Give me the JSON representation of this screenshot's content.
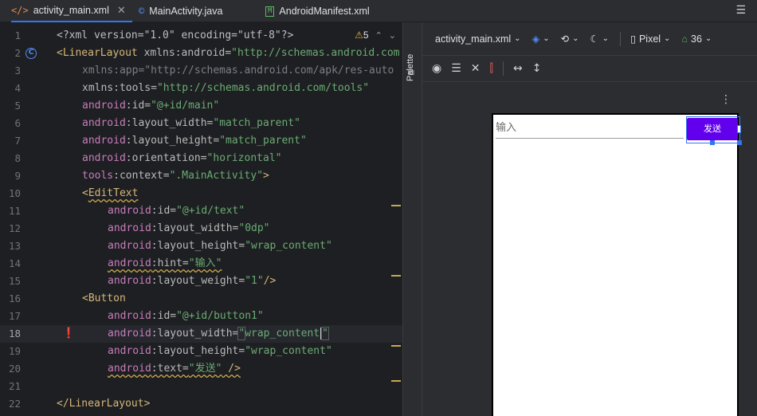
{
  "tabs": [
    {
      "label": "activity_main.xml",
      "icon": "</>",
      "active": true,
      "close": "✕"
    },
    {
      "label": "MainActivity.java",
      "icon": "©",
      "active": false
    },
    {
      "label": "AndroidManifest.xml",
      "icon": "M",
      "active": false
    }
  ],
  "editor": {
    "warning_count": "5",
    "lines": [
      {
        "n": "1"
      },
      {
        "n": "2"
      },
      {
        "n": "3"
      },
      {
        "n": "4"
      },
      {
        "n": "5"
      },
      {
        "n": "6"
      },
      {
        "n": "7"
      },
      {
        "n": "8"
      },
      {
        "n": "9"
      },
      {
        "n": "10"
      },
      {
        "n": "11"
      },
      {
        "n": "12"
      },
      {
        "n": "13"
      },
      {
        "n": "14"
      },
      {
        "n": "15"
      },
      {
        "n": "16"
      },
      {
        "n": "17"
      },
      {
        "n": "18"
      },
      {
        "n": "19"
      },
      {
        "n": "20"
      },
      {
        "n": "21"
      },
      {
        "n": "22"
      }
    ],
    "code": {
      "l1": "<?xml version=\"1.0\" encoding=\"utf-8\"?>",
      "l2_tag": "<LinearLayout",
      "l2_ns": "xmlns",
      "l2_attr": ":android=",
      "l2_str": "\"http://schemas.android.com",
      "l3": "xmlns:app=\"http://schemas.android.com/apk/res-auto",
      "l4_ns": "xmlns",
      "l4_attr": ":tools=",
      "l4_str": "\"http://schemas.android.com/tools\"",
      "l5_ns": "android",
      "l5_attr": ":id=",
      "l5_str": "\"@+id/main\"",
      "l6_ns": "android",
      "l6_attr": ":layout_width=",
      "l6_str": "\"match_parent\"",
      "l7_ns": "android",
      "l7_attr": ":layout_height=",
      "l7_str": "\"match_parent\"",
      "l8_ns": "android",
      "l8_attr": ":orientation=",
      "l8_str": "\"horizontal\"",
      "l9_ns": "tools",
      "l9_attr": ":context=",
      "l9_str": "\".MainActivity\"",
      "l9_end": ">",
      "l10_lt": "<",
      "l10_tag": "EditText",
      "l11_ns": "android",
      "l11_attr": ":id=",
      "l11_str": "\"@+id/text\"",
      "l12_ns": "android",
      "l12_attr": ":layout_width=",
      "l12_str": "\"0dp\"",
      "l13_ns": "android",
      "l13_attr": ":layout_height=",
      "l13_str": "\"wrap_content\"",
      "l14_ns": "android",
      "l14_attr": ":hint=",
      "l14_str": "\"输入\"",
      "l15_ns": "android",
      "l15_attr": ":layout_weight=",
      "l15_str": "\"1\"",
      "l15_end": "/>",
      "l16_tag": "<Button",
      "l17_ns": "android",
      "l17_attr": ":id=",
      "l17_str": "\"@+id/button1\"",
      "l18_ns": "android",
      "l18_attr": ":layout_width=",
      "l18_q1": "\"",
      "l18_str": "wrap_content",
      "l18_q2": "\"",
      "l19_ns": "android",
      "l19_attr": ":layout_height=",
      "l19_str": "\"wrap_content\"",
      "l20_ns": "android",
      "l20_attr": ":text=",
      "l20_str": "\"发送\"",
      "l20_end": " />",
      "l22": "</LinearLayout>"
    }
  },
  "palette": {
    "label": "Palette"
  },
  "design": {
    "file_select": "activity_main.xml",
    "device": "Pixel",
    "api": "36",
    "preview": {
      "edittext_hint": "输入",
      "button_label": "发送"
    }
  },
  "colors": {
    "accent": "#3574f0",
    "button": "#6200ee"
  }
}
